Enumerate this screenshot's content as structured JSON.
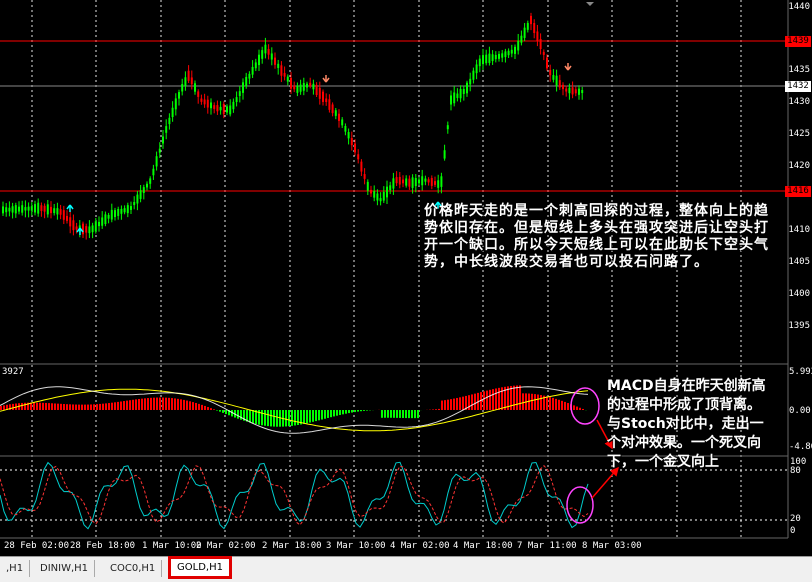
{
  "chart": {
    "price_scale": [
      "1440",
      "1435",
      "1430",
      "1425",
      "1420",
      "1415",
      "1410",
      "1405",
      "1400",
      "1395"
    ],
    "price_tags": {
      "resistance": "1439",
      "current": "1432",
      "support": "1416"
    },
    "time_axis": [
      "28 Feb 02:00",
      "28 Feb 18:00",
      "1 Mar 10:00",
      "2 Mar 02:00",
      "2 Mar 18:00",
      "3 Mar 10:00",
      "4 Mar 02:00",
      "4 Mar 18:00",
      "7 Mar 11:00",
      "8 Mar 03:00"
    ],
    "macd": {
      "left_value": "3927",
      "scale": [
        "5.993",
        "0.00",
        "-4.86"
      ]
    },
    "stoch": {
      "scale": [
        "100",
        "80",
        "20",
        "0"
      ]
    },
    "colors": {
      "bull": "#00ff00",
      "bear": "#ff0000",
      "grid": "#ffffff",
      "signal": "#ffff00",
      "stoch_main": "#00cccc",
      "stoch_signal": "#ff3333",
      "circle": "#ff44ff",
      "arrow_up": "#00ffff",
      "arrow_down": "#ff8866"
    }
  },
  "annotations": {
    "main": "价格昨天走的是一个刺高回探的过程，整体向上的趋势依旧存在。但是短线上多头在强攻突进后让空头打开一个缺口。所以今天短线上可以在此助长下空头气势，中长线波段交易者也可以投石问路了。",
    "side": "MACD自身在昨天创新高的过程中形成了顶背离。与Stoch对比中，走出一个对冲效果。一个死叉向下，一个金叉向上"
  },
  "tabs": [
    ",H1",
    "DINIW,H1",
    "COC0,H1",
    "GOLD,H1"
  ],
  "active_tab": "GOLD,H1"
}
